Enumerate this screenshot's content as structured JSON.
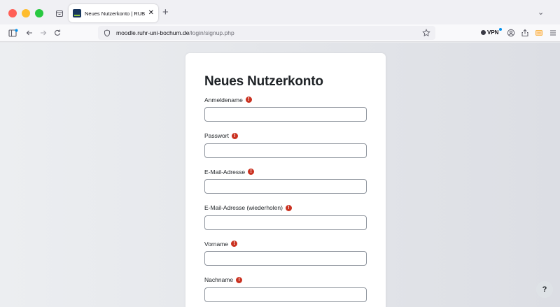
{
  "browser": {
    "tab_title": "Neues Nutzerkonto | RUB Mood",
    "tab_close": "✕",
    "new_tab": "+",
    "tab_overflow": "⌄",
    "url_host": "moodle.ruhr-uni-bochum.de",
    "url_path": "/login/signup.php",
    "vpn_label": "VPN",
    "colors": {
      "accent_blue": "#0090ed",
      "chrome_bg": "#f0f0f4"
    }
  },
  "form": {
    "title": "Neues Nutzerkonto",
    "required_marker": "!",
    "fields": [
      {
        "label": "Anmeldename",
        "value": ""
      },
      {
        "label": "Passwort",
        "value": ""
      },
      {
        "label": "E-Mail-Adresse",
        "value": ""
      },
      {
        "label": "E-Mail-Adresse (wiederholen)",
        "value": ""
      },
      {
        "label": "Vorname",
        "value": ""
      },
      {
        "label": "Nachname",
        "value": ""
      }
    ],
    "colors": {
      "required": "#ca3120",
      "text": "#1d2125"
    }
  },
  "help": {
    "label": "?"
  }
}
